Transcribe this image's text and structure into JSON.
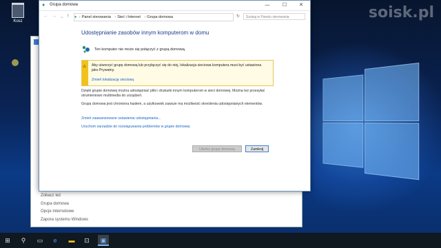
{
  "desktop": {
    "recycle_bin_label": "Kosz",
    "watermark": "soisk.pl"
  },
  "background_window": {
    "see_also_items": [
      "Zobacz też",
      "Grupa domowa",
      "Opcje internetowe",
      "Zapora systemu Windows"
    ]
  },
  "window": {
    "title": "Grupa domowa",
    "breadcrumb": [
      "Panel sterowania",
      "Sieć i Internet",
      "Grupa domowa"
    ],
    "search_placeholder": "Szukaj w Panelu sterowania",
    "heading": "Udostępnianie zasobów innym komputerom w domu",
    "status": "Ten komputer nie może się połączyć z grupą domową.",
    "warning_text": "Aby utworzyć grupę domową lub przyłączyć się do niej, lokalizacja sieciowa komputera musi być ustawiona jako Prywatny.",
    "warning_link": "Zmień lokalizację sieciową",
    "paragraph1": "Dzięki grupie domowej można udostępniać pliki i drukarki innym komputerom w sieci domowej. Można też przesyłać strumieniowo multimedia do urządzeń.",
    "paragraph2": "Grupa domowa jest chroniona hasłem, a użytkownik zawsze ma możliwość określenia udostępnianych elementów.",
    "link_advanced": "Zmień zaawansowane ustawienia udostępniania...",
    "link_troubleshoot": "Uruchom narzędzie do rozwiązywania problemów w grupie domowej",
    "button_create": "Utwórz grupę domową",
    "button_close": "Zamknij"
  },
  "taskbar": {
    "items": [
      "start-icon",
      "search-icon",
      "task-view-icon",
      "edge-icon",
      "file-explorer-icon",
      "store-icon",
      "control-panel-icon"
    ]
  },
  "colors": {
    "heading": "#1e3b8a",
    "link": "#1565c0",
    "warning": "#f2c21b"
  }
}
